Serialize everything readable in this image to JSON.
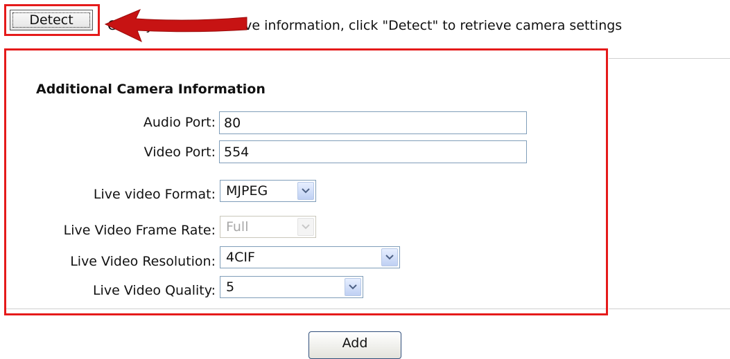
{
  "detect": {
    "button_label": "Detect",
    "hint": "Once you fill out above information, click \"Detect\" to retrieve camera settings"
  },
  "section": {
    "title": "Additional Camera Information",
    "fields": {
      "audio_port": {
        "label": "Audio Port:",
        "value": "80"
      },
      "video_port": {
        "label": "Video Port:",
        "value": "554"
      },
      "live_format": {
        "label": "Live video Format:",
        "value": "MJPEG"
      },
      "frame_rate": {
        "label": "Live Video Frame Rate:",
        "value": "Full",
        "disabled": true
      },
      "resolution": {
        "label": "Live Video Resolution:",
        "value": "4CIF"
      },
      "quality": {
        "label": "Live Video Quality:",
        "value": "5"
      }
    }
  },
  "actions": {
    "add_label": "Add"
  },
  "colors": {
    "highlight": "#e51a1a",
    "arrow": "#c71313",
    "input_border": "#7f9db9"
  },
  "icons": {
    "dropdown": "chevron-down-icon",
    "arrow": "red-arrow-annotation"
  }
}
